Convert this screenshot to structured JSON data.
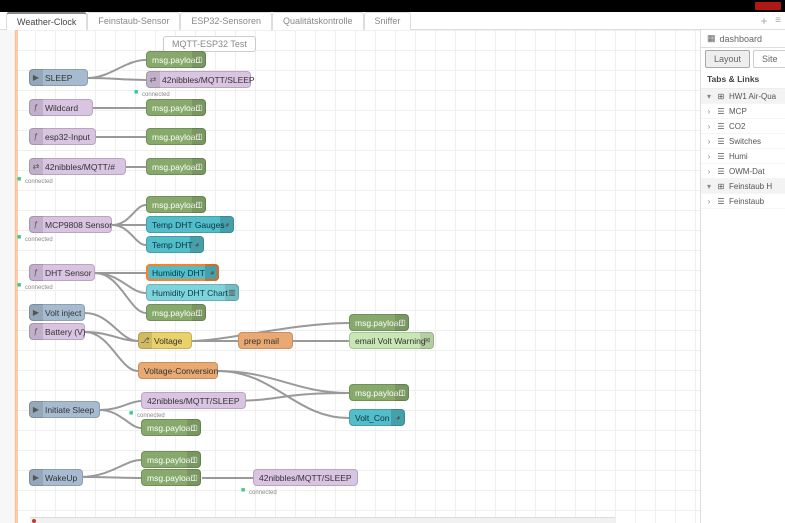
{
  "window": {
    "close": "x"
  },
  "tabs": {
    "items": [
      {
        "label": "Weather-Clock",
        "active": true
      },
      {
        "label": "Feinstaub-Sensor",
        "active": false
      },
      {
        "label": "ESP32-Sensoren",
        "active": false
      },
      {
        "label": "Qualitätskontrolle",
        "active": false
      },
      {
        "label": "Sniffer",
        "active": false
      }
    ],
    "plus": "+",
    "menu": "≡"
  },
  "canvas": {
    "subflowLabel": "MQTT-ESP32 Test",
    "nodes": {
      "sleep": {
        "label": "SLEEP",
        "status": ""
      },
      "wildcard": {
        "label": "Wildcard",
        "status": ""
      },
      "esp32input": {
        "label": "esp32-Input",
        "status": ""
      },
      "mqtt42": {
        "label": "42nibbles/MQTT/#",
        "status": "connected"
      },
      "mcp": {
        "label": "MCP9808 Sensor",
        "status": "connected"
      },
      "dht": {
        "label": "DHT Sensor",
        "status": "connected"
      },
      "voltinject": {
        "label": "Volt inject",
        "status": ""
      },
      "battery": {
        "label": "Battery (V)",
        "status": ""
      },
      "initsleep": {
        "label": "Initiate Sleep",
        "status": ""
      },
      "wakeup": {
        "label": "WakeUp",
        "status": ""
      },
      "pay1": {
        "label": "msg.payload"
      },
      "pay2": {
        "label": "msg.payload"
      },
      "pay3": {
        "label": "msg.payload"
      },
      "pay4": {
        "label": "msg.payload"
      },
      "pay5": {
        "label": "msg.payload"
      },
      "pay6": {
        "label": "msg.payload"
      },
      "pay7": {
        "label": "msg.payload"
      },
      "pay8": {
        "label": "msg.payload"
      },
      "pay9": {
        "label": "msg.payload"
      },
      "pay10": {
        "label": "msg.payload"
      },
      "pay11": {
        "label": "msg.payload"
      },
      "mqttOutSleep1": {
        "label": "42nibbles/MQTT/SLEEP",
        "status": "connected"
      },
      "mqttOutSleep2": {
        "label": "42nibbles/MQTT/SLEEP",
        "status": "connected"
      },
      "mqttOutSleep3": {
        "label": "42nibbles/MQTT/SLEEP",
        "status": "connected"
      },
      "tempGauge": {
        "label": "Temp DHT Gauges"
      },
      "tempDHT": {
        "label": "Temp DHT"
      },
      "humDHT": {
        "label": "Humidity DHT"
      },
      "humChart": {
        "label": "Humidity DHT Chart"
      },
      "voltage": {
        "label": "Voltage"
      },
      "voltConv": {
        "label": "Voltage-Conversion"
      },
      "prepmail": {
        "label": "prep mail"
      },
      "emailWarn": {
        "label": "email Volt Warning"
      },
      "voltCon": {
        "label": "Volt_Con"
      }
    }
  },
  "sidebar": {
    "title": "dashboard",
    "tabs": {
      "layout": "Layout",
      "site": "Site"
    },
    "section": "Tabs & Links",
    "tree": [
      {
        "type": "group",
        "label": "HW1 Air-Qua",
        "expanded": true
      },
      {
        "type": "item",
        "label": "MCP"
      },
      {
        "type": "item",
        "label": "CO2"
      },
      {
        "type": "item",
        "label": "Switches"
      },
      {
        "type": "item",
        "label": "Humi"
      },
      {
        "type": "item",
        "label": "OWM-Dat"
      },
      {
        "type": "group",
        "label": "Feinstaub H",
        "expanded": true
      },
      {
        "type": "item",
        "label": "Feinstaub"
      }
    ]
  },
  "icons": {
    "inject": "▶",
    "debug": "▢",
    "gauge": "◕",
    "chart": "▥",
    "switch": "⎇",
    "function": "ƒ",
    "mqtt": "⇄",
    "mail": "✉",
    "dash": "▦",
    "tab": "⊞",
    "grp": "☰",
    "chevd": "▾",
    "chevr": "›"
  }
}
